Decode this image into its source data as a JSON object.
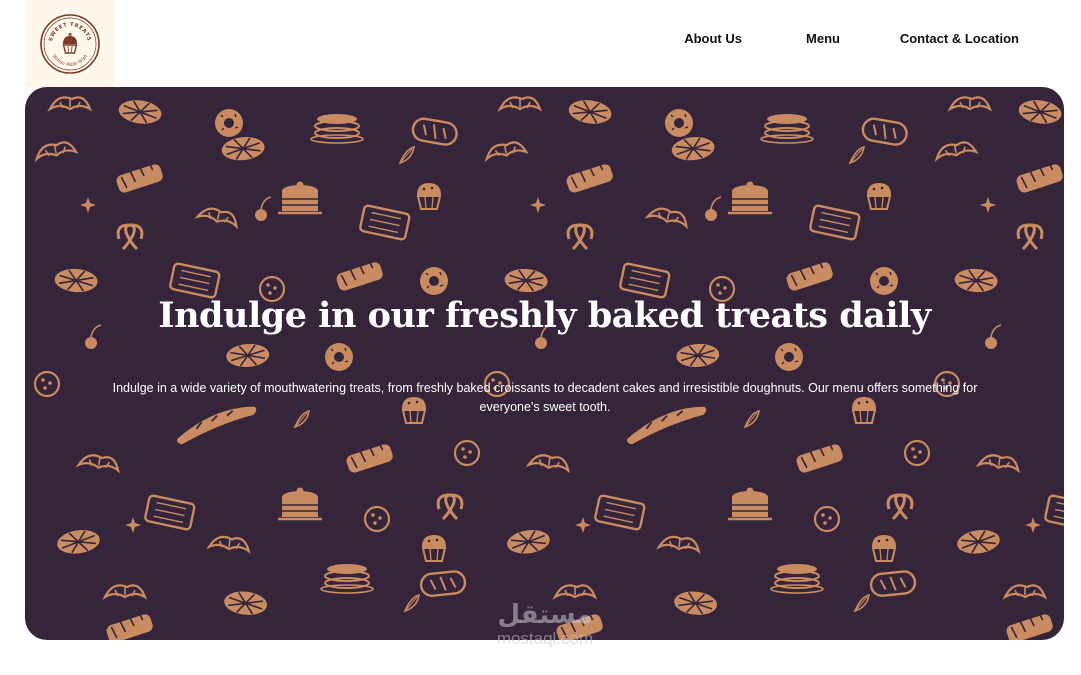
{
  "brand": {
    "logo_top_text": "SWEET TREATS",
    "logo_bottom_text": "Within Walls Wish",
    "logo_icon": "cupcake-icon",
    "accent_color": "#7a3a2a",
    "logo_background": "#fdf8ea"
  },
  "nav": {
    "items": [
      {
        "label": "About Us"
      },
      {
        "label": "Menu"
      },
      {
        "label": "Contact & Location"
      }
    ]
  },
  "hero": {
    "title": "Indulge in our freshly baked treats daily",
    "description": "Indulge in a wide variety of mouthwatering treats, from freshly baked croissants to decadent cakes and irresistible doughnuts. Our menu offers something for everyone's sweet tooth.",
    "background_color": "#35243a",
    "pattern_color": "#c98b62",
    "pattern_icons": [
      "croissant-icon",
      "cake-icon",
      "pie-icon",
      "bread-icon",
      "cupcake-icon",
      "donut-icon",
      "baguette-icon",
      "cookie-icon",
      "pretzel-icon",
      "cherry-icon",
      "strawberry-icon",
      "leaf-icon",
      "star-anise-icon"
    ]
  },
  "watermark": {
    "logo_text": "مستقل",
    "url": "mostaql.com"
  }
}
